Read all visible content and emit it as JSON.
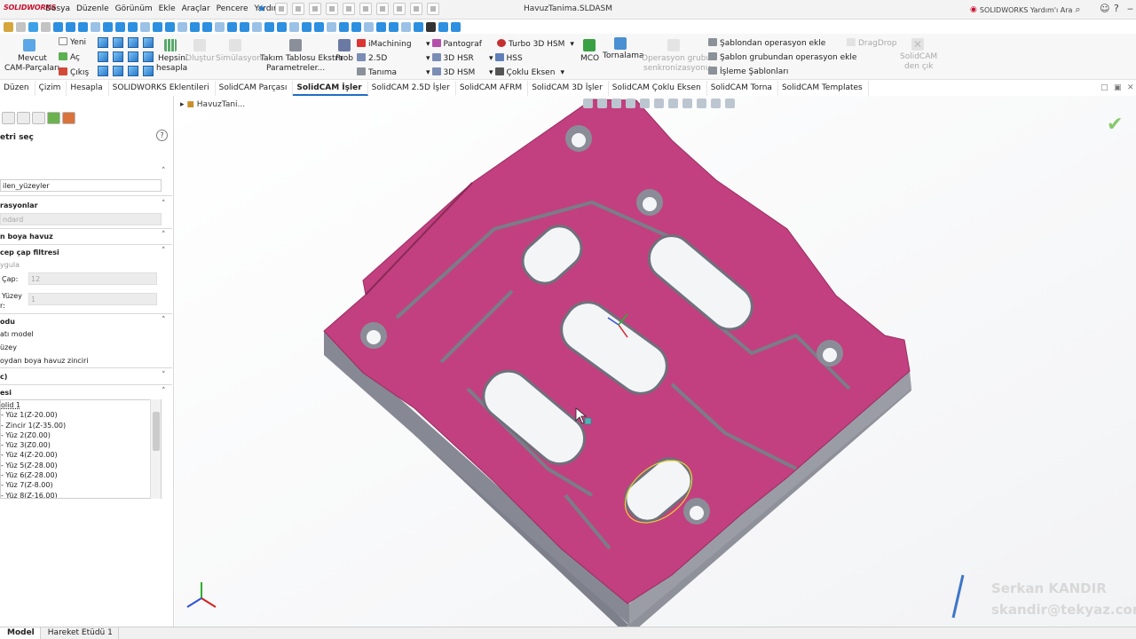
{
  "app": {
    "brand": "SOLIDWORKS",
    "document_title": "HavuzTanima.SLDASM",
    "menu": [
      "Dosya",
      "Düzenle",
      "Görünüm",
      "Ekle",
      "Araçlar",
      "Pencere",
      "Yardım"
    ],
    "help_search_placeholder": "SOLIDWORKS Yardım'ı Ara"
  },
  "ribbon": {
    "mevcut": "Mevcut",
    "cam_parcalari": "CAM-Parçaları",
    "yeni": "Yeni",
    "ac": "Aç",
    "cikis": "Çıkış",
    "hepsini": "Hepsini",
    "hesapla": "hesapla",
    "olustur": "Oluştur",
    "simulasyon": "Simülasyon",
    "takim_tablosu": "Takım Tablosu Ekstra",
    "parametreler": "Parametreler...",
    "prob": "Prob",
    "imachining": "iMachining",
    "d25": "2.5D",
    "tanima": "Tanıma",
    "pantograf": "Pantograf",
    "hsr3d": "3D HSR",
    "hsm3d": "3D HSM",
    "turbo": "Turbo 3D HSM",
    "hss": "HSS",
    "coklu_eksen": "Çoklu Eksen",
    "mco": "MCO",
    "tornalama": "Tornalama",
    "operasyon_grubu": "Operasyon grubu",
    "senkronizasyonu": "senkronizasyonu",
    "sablondan": "Şablondan operasyon ekle",
    "sablon_grubundan": "Şablon grubundan operasyon ekle",
    "isleme_sablonlari": "İşleme Şablonları",
    "dragdrop": "DragDrop",
    "solidcam": "SolidCAM",
    "den_cik": "den çık"
  },
  "tabs": [
    "Düzen",
    "Çizim",
    "Hesapla",
    "SOLIDWORKS Eklentileri",
    "SolidCAM Parçası",
    "SolidCAM İşler",
    "SolidCAM 2.5D İşler",
    "SolidCAM AFRM",
    "SolidCAM 3D İşler",
    "SolidCAM Çoklu Eksen",
    "SolidCAM Torna",
    "SolidCAM Templates"
  ],
  "active_tab": "SolidCAM İşler",
  "panel": {
    "title": "etri seç",
    "input_value": "ilen_yüzeyler",
    "s_operasyonlar": "rasyonlar",
    "combo_value": "ndard",
    "s_boya_havuz": "n boya havuz",
    "s_cep_cap": "cep çap filtresi",
    "uygula": "ygula",
    "cap_label": "Çap:",
    "cap_value": "12",
    "yuzey_label_1": "Yüzey",
    "yuzey_label_2": "r:",
    "yuzey_value": "1",
    "s_modu": "odu",
    "opt_kati": "atı model",
    "opt_yuzey": "üzey",
    "opt_zincir": "oydan boya havuz zinciri",
    "s_c": "c)",
    "s_list": "esi",
    "list_items": [
      "olid 1",
      "- Zincir 1(Z-35.00)",
      "- Yüz 1(Z-20.00)",
      "- Yüz 2(Z0.00)",
      "- Yüz 3(Z0.00)",
      "- Yüz 4(Z-20.00)",
      "- Yüz 5(Z-28.00)",
      "- Yüz 6(Z-28.00)",
      "- Yüz 7(Z-8.00)",
      "- Yüz 8(Z-16.00)"
    ]
  },
  "viewport": {
    "breadcrumb": "HavuzTani...",
    "watermark_name": "Serkan KANDIR",
    "watermark_email": "skandir@tekyaz.com",
    "part_color": "#c2407f",
    "side_color": "#82858f"
  },
  "bottom_tabs": [
    "Model",
    "Hareket Etüdü 1"
  ]
}
